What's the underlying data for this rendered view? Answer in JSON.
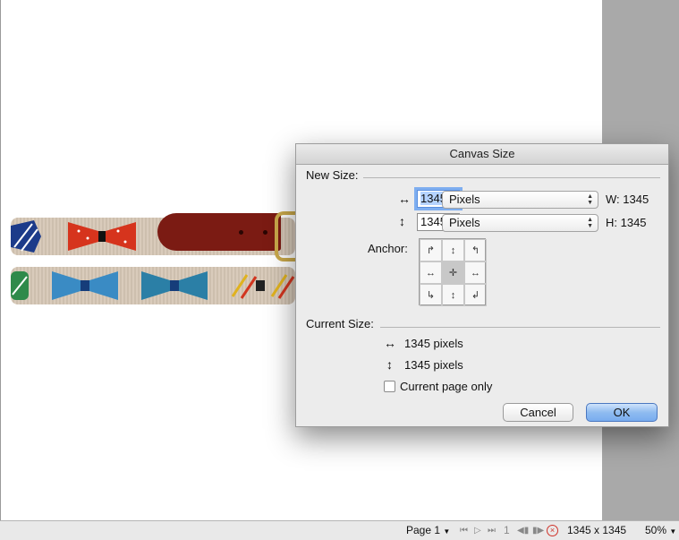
{
  "dialog": {
    "title": "Canvas Size",
    "new_size_label": "New Size:",
    "width_value": "1345",
    "height_value": "1345",
    "width_unit": "Pixels",
    "height_unit": "Pixels",
    "width_readout": "W: 1345",
    "height_readout": "H: 1345",
    "anchor_label": "Anchor:",
    "current_size_label": "Current Size:",
    "current_width": "1345 pixels",
    "current_height": "1345 pixels",
    "current_page_only_label": "Current page only",
    "current_page_only_checked": false,
    "cancel_label": "Cancel",
    "ok_label": "OK",
    "anchor_selected": "center"
  },
  "statusbar": {
    "page_label": "Page 1",
    "page_number": "1",
    "dimensions": "1345 x 1345",
    "zoom": "50%"
  },
  "icons": {
    "width_arrow": "↔",
    "height_arrow": "↕",
    "nav_first": "⏮",
    "nav_play": "▷",
    "nav_last": "⏭"
  },
  "colors": {
    "ok_button": "#79acef",
    "focus_ring": "#7eaef0",
    "canvas": "#ffffff",
    "background": "#a9a9a9"
  }
}
